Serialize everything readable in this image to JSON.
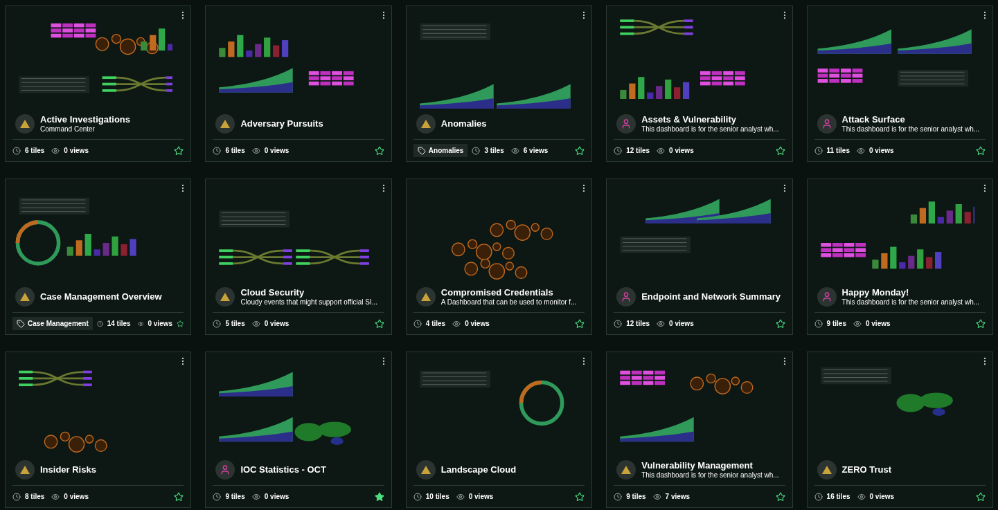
{
  "dashboards": [
    {
      "title": "Active Investigations",
      "subtitle": "Command Center",
      "kind": "triangle",
      "tiles": "6 tiles",
      "views": "0 views",
      "starred": false
    },
    {
      "title": "Adversary Pursuits",
      "kind": "triangle",
      "tiles": "6 tiles",
      "views": "0 views",
      "starred": false
    },
    {
      "title": "Anomalies",
      "kind": "triangle",
      "tag": "Anomalies",
      "tiles": "3 tiles",
      "views": "6 views",
      "starred": false
    },
    {
      "title": "Assets & Vulnerability",
      "subtitle": "This dashboard is for the senior analyst wh...",
      "kind": "person",
      "tiles": "12 tiles",
      "views": "0 views",
      "starred": false
    },
    {
      "title": "Attack Surface",
      "subtitle": "This dashboard is for the senior analyst wh...",
      "kind": "person",
      "tiles": "11 tiles",
      "views": "0 views",
      "starred": false
    },
    {
      "title": "Case Management Overview",
      "kind": "triangle",
      "tag": "Case Management",
      "tiles": "14 tiles",
      "views": "0 views",
      "starred": false
    },
    {
      "title": "Cloud Security",
      "subtitle": "Cloudy events that might support official SI...",
      "kind": "triangle",
      "tiles": "5 tiles",
      "views": "0 views",
      "starred": false
    },
    {
      "title": "Compromised Credentials",
      "subtitle": "A Dashboard that can be used to monitor f...",
      "kind": "triangle",
      "tiles": "4 tiles",
      "views": "0 views",
      "starred": false
    },
    {
      "title": "Endpoint and Network Summary",
      "kind": "person",
      "tiles": "12 tiles",
      "views": "0 views",
      "starred": false
    },
    {
      "title": "Happy Monday!",
      "subtitle": "This dashboard is for the senior analyst wh...",
      "kind": "person",
      "tiles": "9 tiles",
      "views": "0 views",
      "starred": false
    },
    {
      "title": "Insider Risks",
      "kind": "triangle",
      "tiles": "8 tiles",
      "views": "0 views",
      "starred": false
    },
    {
      "title": "IOC Statistics - OCT",
      "kind": "person",
      "tiles": "9 tiles",
      "views": "0 views",
      "starred": true
    },
    {
      "title": "Landscape Cloud",
      "kind": "triangle",
      "tiles": "10 tiles",
      "views": "0 views",
      "starred": false
    },
    {
      "title": "Vulnerability Management",
      "subtitle": "This dashboard is for the senior analyst wh...",
      "kind": "triangle",
      "tiles": "9 tiles",
      "views": "7 views",
      "starred": false
    },
    {
      "title": "ZERO Trust",
      "kind": "triangle",
      "tiles": "16 tiles",
      "views": "0 views",
      "starred": false
    }
  ]
}
